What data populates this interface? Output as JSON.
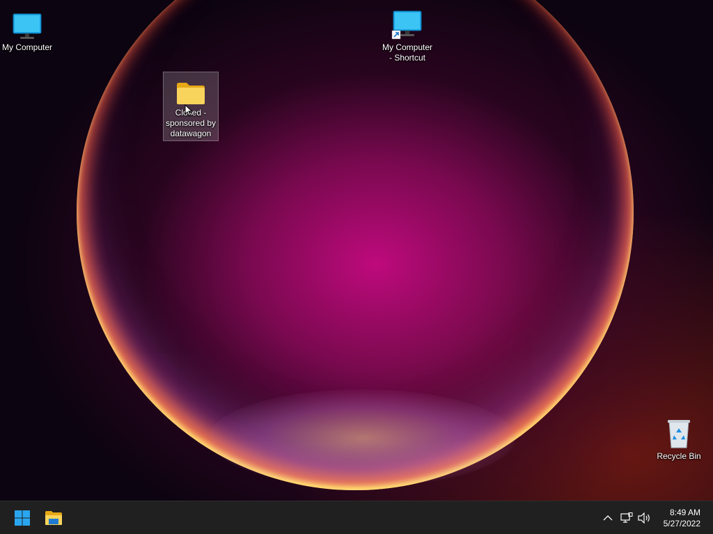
{
  "desktop": {
    "icons": [
      {
        "label": "My Computer"
      },
      {
        "label": "My Computer\n- Shortcut"
      },
      {
        "label": "Closed -\nsponsored by\ndatawagon"
      },
      {
        "label": "Recycle Bin"
      }
    ]
  },
  "taskbar": {
    "start_icon": "windows-start-icon",
    "pinned": [
      "file-explorer-icon"
    ],
    "tray": [
      "chevron-up-icon",
      "network-icon",
      "volume-icon"
    ],
    "time": "8:49 AM",
    "date": "5/27/2022"
  },
  "colors": {
    "accent": "#0078d4",
    "taskbar": "#202020",
    "folder": "#f7c948"
  }
}
